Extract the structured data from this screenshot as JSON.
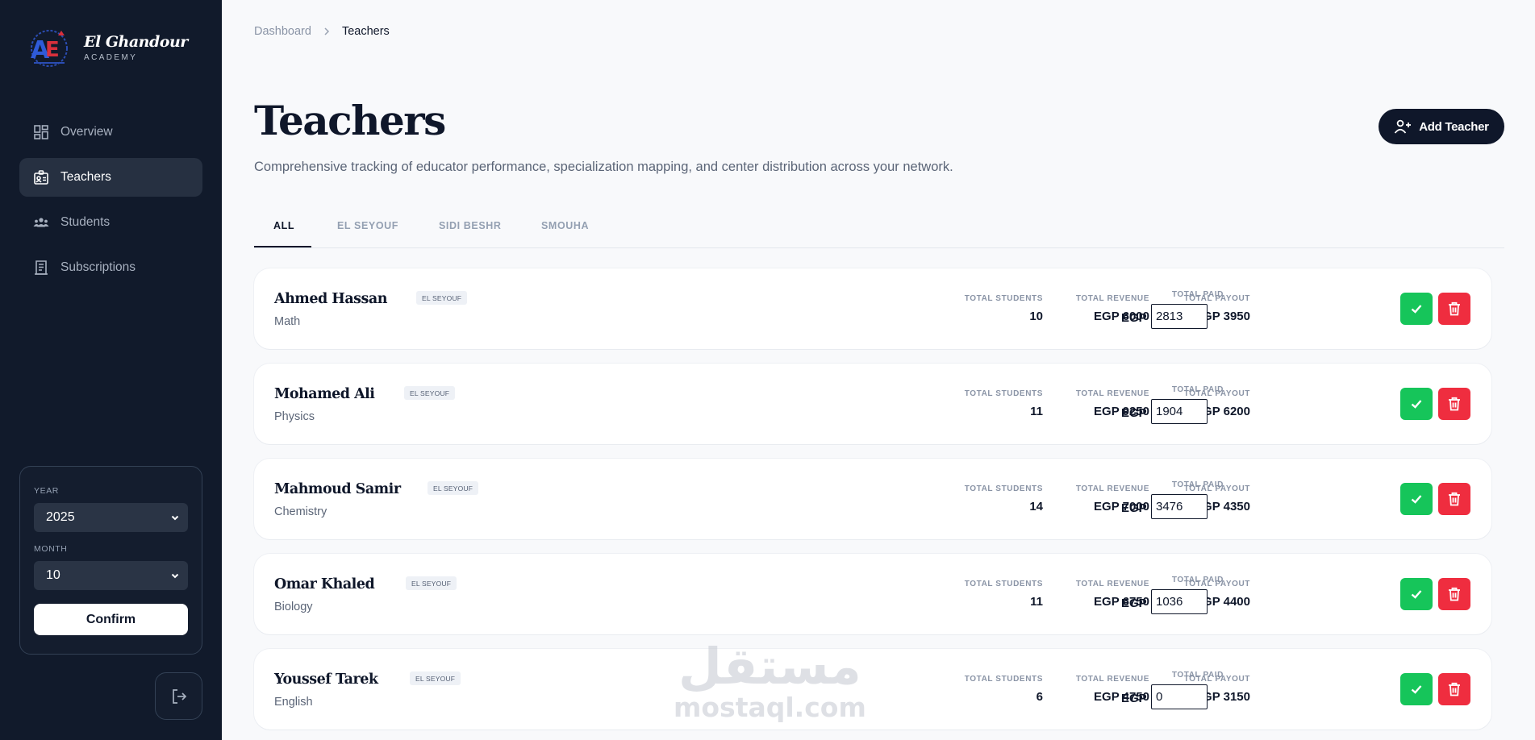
{
  "brand": {
    "name": "El Ghandour",
    "sub": "ACADEMY"
  },
  "nav": [
    {
      "label": "Overview",
      "icon": "dashboard-icon",
      "active": false
    },
    {
      "label": "Teachers",
      "icon": "id-badge-icon",
      "active": true
    },
    {
      "label": "Students",
      "icon": "users-icon",
      "active": false
    },
    {
      "label": "Subscriptions",
      "icon": "receipt-icon",
      "active": false
    }
  ],
  "period": {
    "year_label": "YEAR",
    "year_value": "2025",
    "month_label": "MONTH",
    "month_value": "10",
    "confirm_label": "Confirm"
  },
  "breadcrumb": {
    "home": "Dashboard",
    "current": "Teachers"
  },
  "page": {
    "title": "Teachers",
    "subtitle": "Comprehensive tracking of educator performance, specialization mapping, and center distribution across your network.",
    "add_button": "Add Teacher"
  },
  "tabs": [
    "ALL",
    "EL SEYOUF",
    "SIDI BESHR",
    "SMOUHA"
  ],
  "labels": {
    "total_students": "TOTAL STUDENTS",
    "total_revenue": "TOTAL REVENUE",
    "total_payout": "TOTAL PAYOUT",
    "total_paid": "TOTAL PAID",
    "currency": "EGP"
  },
  "teachers": [
    {
      "name": "Ahmed Hassan",
      "badge": "EL SEYOUF",
      "subject": "Math",
      "students": "10",
      "revenue": "EGP 6000",
      "payout": "EGP 3950",
      "paid": "2813"
    },
    {
      "name": "Mohamed Ali",
      "badge": "EL SEYOUF",
      "subject": "Physics",
      "students": "11",
      "revenue": "EGP 9250",
      "payout": "EGP 6200",
      "paid": "1904"
    },
    {
      "name": "Mahmoud Samir",
      "badge": "EL SEYOUF",
      "subject": "Chemistry",
      "students": "14",
      "revenue": "EGP 7000",
      "payout": "EGP 4350",
      "paid": "3476"
    },
    {
      "name": "Omar Khaled",
      "badge": "EL SEYOUF",
      "subject": "Biology",
      "students": "11",
      "revenue": "EGP 6750",
      "payout": "EGP 4400",
      "paid": "1036"
    },
    {
      "name": "Youssef Tarek",
      "badge": "EL SEYOUF",
      "subject": "English",
      "students": "6",
      "revenue": "EGP 4750",
      "payout": "EGP 3150",
      "paid": "0"
    }
  ],
  "watermark": {
    "arabic": "مستقل",
    "latin": "mostaql.com"
  },
  "colors": {
    "sidebar": "#111a2b",
    "primary": "#0f172a",
    "success": "#16c55a",
    "danger": "#ef2d3f"
  }
}
